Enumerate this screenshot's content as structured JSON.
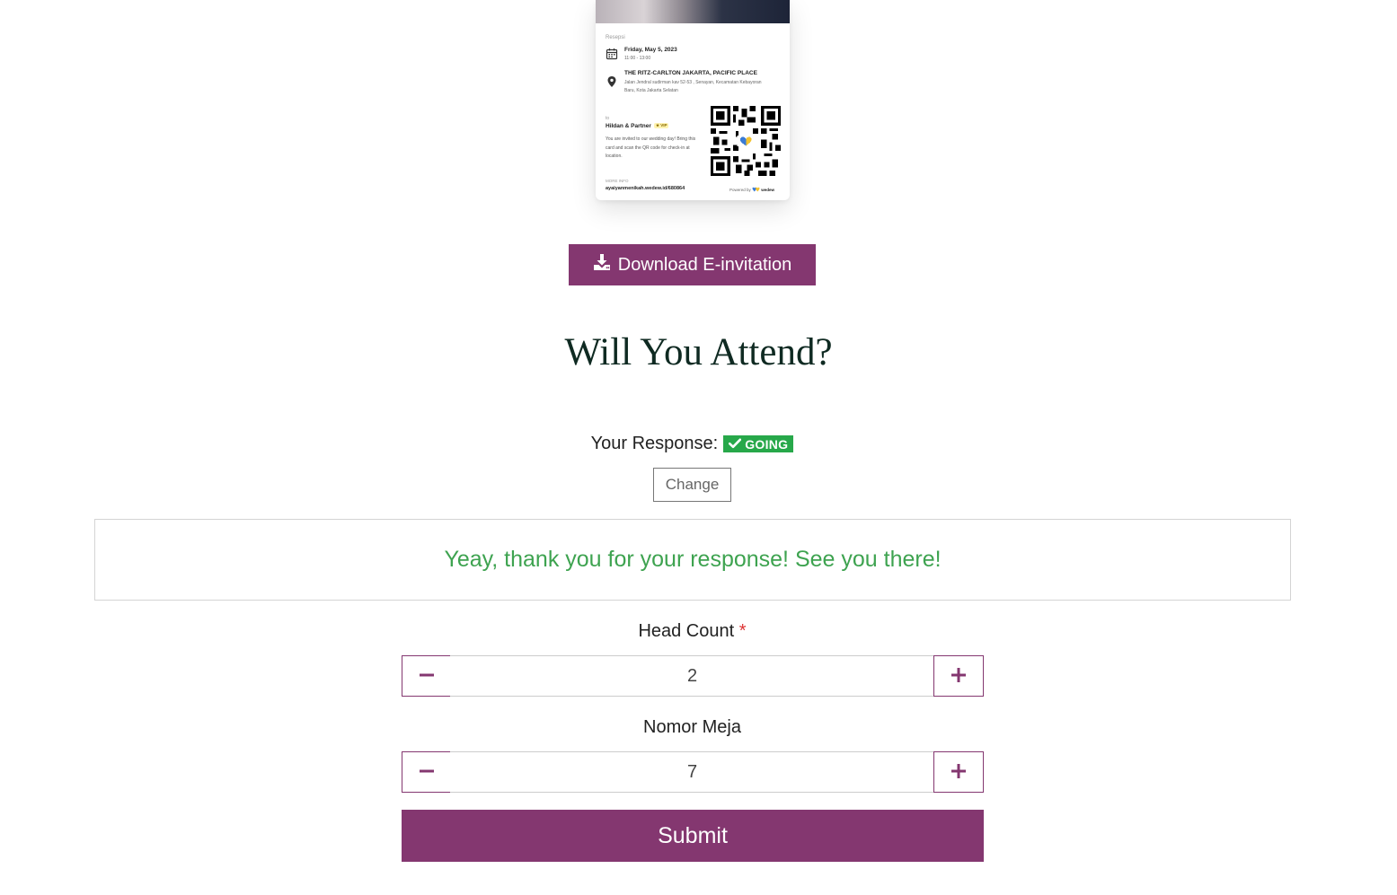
{
  "invitation_card": {
    "event_label": "Resepsi",
    "date": "Friday, May 5, 2023",
    "time": "11:00 - 13:00",
    "venue": "THE RITZ-CARLTON JAKARTA, PACIFIC PLACE",
    "address": "Jalan Jendral sudirman kav 52-53 , Senayan, Kecamatan Kebayoran Baru, Kota Jakarta Selatan",
    "to_label": "to",
    "guest_name": "Hildan & Partner",
    "guest_badge": "★ VIP",
    "message": "You are invited to our wedding day! Bring this card and scan the QR code for check-in at location.",
    "more_info_label": "MORE INFO",
    "link": "ayaiyanmenikah.wedew.id/680864",
    "powered_by": "Powered by",
    "brand": "wedew",
    "icons": [
      "calendar-icon",
      "location-pin-icon",
      "qr-code",
      "wedew-logo-icon"
    ]
  },
  "download_button": {
    "label": "Download E-invitation",
    "icon": "download-icon"
  },
  "attend": {
    "title": "Will You Attend?",
    "response_label": "Your Response:",
    "response_status": "GOING",
    "response_icon": "check-icon",
    "change_label": "Change",
    "thank_you_message": "Yeay, thank you for your response! See you there!"
  },
  "form": {
    "head_count": {
      "label": "Head Count",
      "required_mark": "*",
      "value": "2"
    },
    "table_number": {
      "label": "Nomor Meja",
      "value": "7"
    },
    "submit_label": "Submit"
  },
  "colors": {
    "primary": "#843770",
    "success_badge": "#27a84a",
    "success_text": "#3ea350",
    "heading": "#0f2a22"
  }
}
